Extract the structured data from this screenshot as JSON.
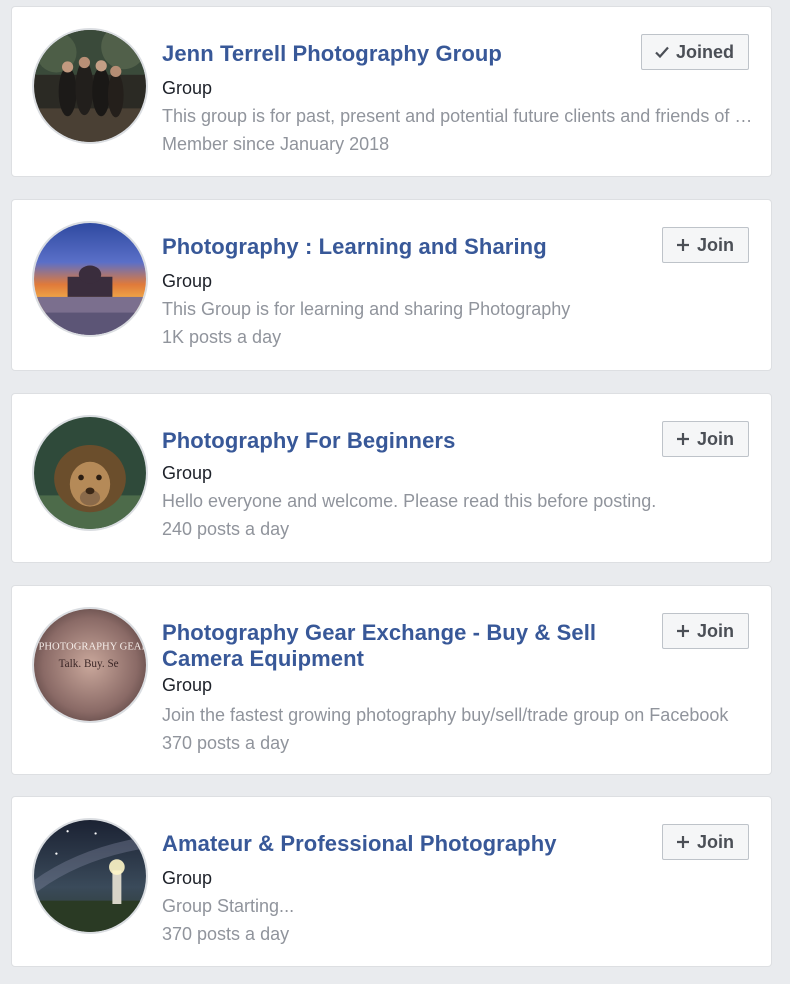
{
  "groups": [
    {
      "name": "Jenn Terrell Photography Group",
      "type": "Group",
      "description": "This group is for past, present and potential future clients and friends of Jenn Terrell Photography",
      "activity": "Member since January 2018",
      "button": {
        "label": "Joined",
        "icon": "check-icon"
      }
    },
    {
      "name": "Photography : Learning and Sharing",
      "type": "Group",
      "description": "This Group is for learning and sharing Photography",
      "activity": "1K posts a day",
      "button": {
        "label": "Join",
        "icon": "plus-icon"
      }
    },
    {
      "name": "Photography For Beginners",
      "type": "Group",
      "description": "Hello everyone and welcome. Please read this before posting.",
      "activity": "240 posts a day",
      "button": {
        "label": "Join",
        "icon": "plus-icon"
      }
    },
    {
      "name": "Photography Gear Exchange - Buy & Sell Camera Equipment",
      "type": "Group",
      "description": "Join the fastest growing photography buy/sell/trade group on Facebook",
      "activity": "370 posts a day",
      "button": {
        "label": "Join",
        "icon": "plus-icon"
      },
      "avatar_text": {
        "line1": "PHOTOGRAPHY GEAR",
        "line2": "Talk. Buy. Se"
      }
    },
    {
      "name": "Amateur & Professional Photography",
      "type": "Group",
      "description": "Group Starting...",
      "activity": "370 posts a day",
      "button": {
        "label": "Join",
        "icon": "plus-icon"
      }
    }
  ],
  "colors": {
    "background": "#e9ebee",
    "link": "#385898",
    "muted": "#90949c",
    "button_bg": "#f5f6f7"
  }
}
